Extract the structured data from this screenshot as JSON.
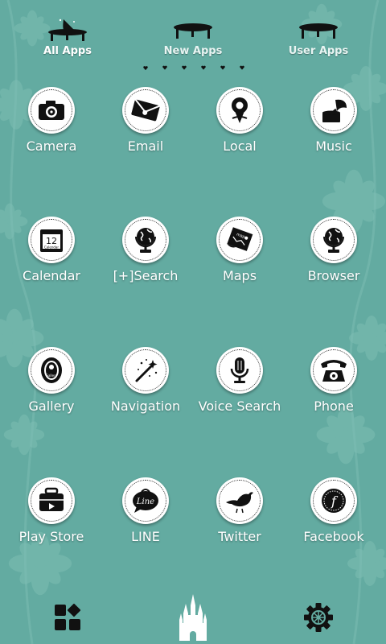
{
  "tabs": [
    {
      "label": "All Apps",
      "active": true
    },
    {
      "label": "New Apps",
      "active": false
    },
    {
      "label": "User Apps",
      "active": false
    }
  ],
  "page_indicator_count": 6,
  "apps": [
    {
      "label": "Camera",
      "icon": "camera-icon"
    },
    {
      "label": "Email",
      "icon": "envelope-icon"
    },
    {
      "label": "Local",
      "icon": "map-pin-icon"
    },
    {
      "label": "Music",
      "icon": "gramophone-icon"
    },
    {
      "label": "Calendar",
      "icon": "calendar-icon",
      "calendar_day": "12",
      "calendar_text": "Calendar"
    },
    {
      "label": "[+]Search",
      "icon": "globe-icon"
    },
    {
      "label": "Maps",
      "icon": "map-icon",
      "map_text": "map"
    },
    {
      "label": "Browser",
      "icon": "globe-icon"
    },
    {
      "label": "Gallery",
      "icon": "picture-frame-icon",
      "frame_text": "Gallery"
    },
    {
      "label": "Navigation",
      "icon": "magic-wand-icon"
    },
    {
      "label": "Voice Search",
      "icon": "microphone-icon"
    },
    {
      "label": "Phone",
      "icon": "telephone-icon"
    },
    {
      "label": "Play Store",
      "icon": "bag-icon"
    },
    {
      "label": "LINE",
      "icon": "speech-bubble-icon",
      "bubble_text": "Line"
    },
    {
      "label": "Twitter",
      "icon": "bird-icon"
    },
    {
      "label": "Facebook",
      "icon": "letter-f-icon",
      "f_text": "f"
    }
  ],
  "dock": [
    {
      "name": "apps-grid-icon"
    },
    {
      "name": "castle-icon"
    },
    {
      "name": "gear-icon"
    }
  ],
  "colors": {
    "background": "#63aba1",
    "icon_fill": "#111111",
    "label": "#ffffff"
  }
}
